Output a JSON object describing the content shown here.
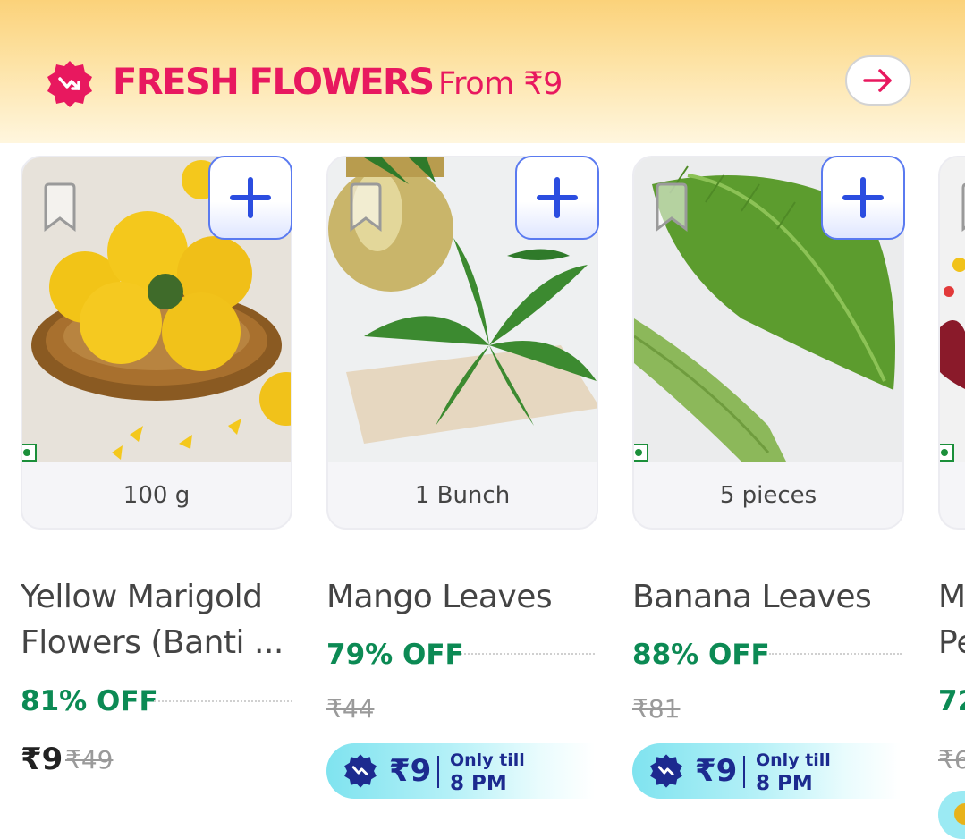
{
  "header": {
    "title": "FRESH FLOWERS",
    "subtitle": "From ₹9"
  },
  "products": [
    {
      "quantity": "100 g",
      "name_line1": "Yellow Marigold",
      "name_line2": "Flowers (Banti ...",
      "discount": "81% OFF",
      "price": "₹9",
      "mrp": "₹49"
    },
    {
      "quantity": "1 Bunch",
      "name_line1": "Mango Leaves",
      "discount": "79% OFF",
      "mrp": "₹44",
      "deal": {
        "price": "₹9",
        "label1": "Only till",
        "label2": "8 PM"
      }
    },
    {
      "quantity": "5 pieces",
      "name_line1": "Banana Leaves",
      "discount": "88% OFF",
      "mrp": "₹81",
      "deal": {
        "price": "₹9",
        "label1": "Only till",
        "label2": "8 PM"
      }
    },
    {
      "name_line1": "M",
      "name_line2": "Pe",
      "discount": "72",
      "mrp": "₹6"
    }
  ],
  "colors": {
    "accent_pink": "#e8185f",
    "discount_green": "#0c8a54",
    "add_blue": "#2b4de0",
    "deal_navy": "#1c2a8f"
  },
  "icons": [
    "discount-badge-icon",
    "arrow-right-icon",
    "bookmark-icon",
    "plus-icon",
    "veg-indicator-icon"
  ]
}
